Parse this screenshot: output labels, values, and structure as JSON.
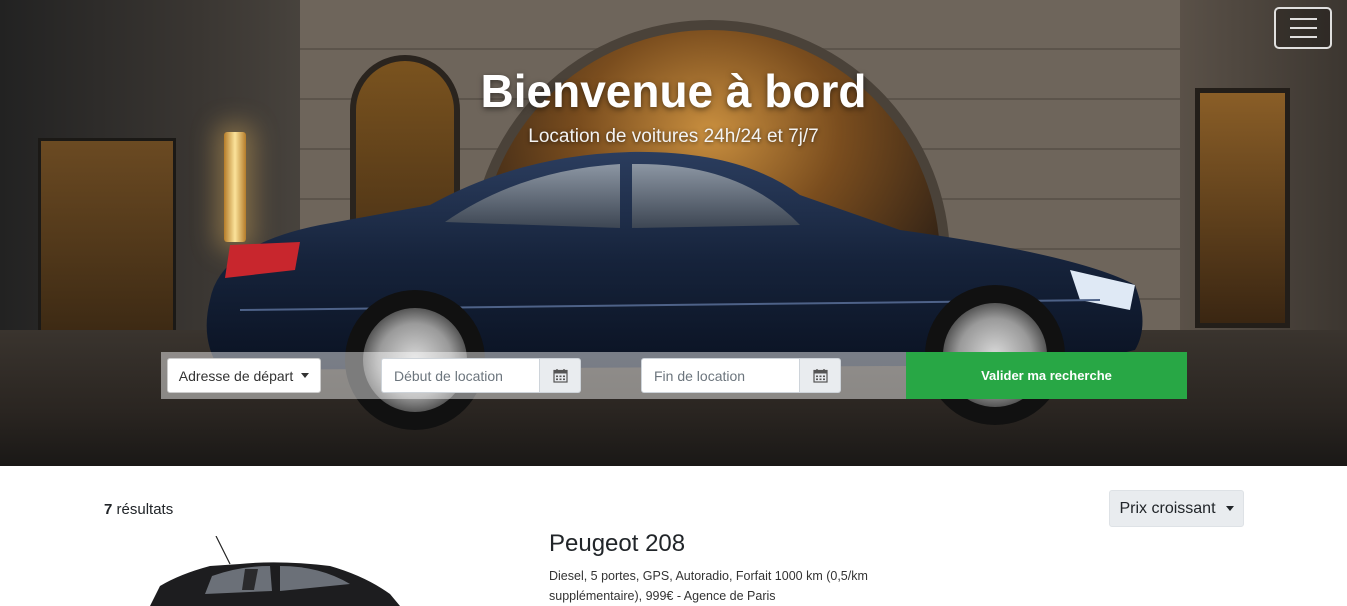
{
  "hero": {
    "title": "Bienvenue à bord",
    "subtitle": "Location de voitures 24h/24 et 7j/7"
  },
  "navbar": {
    "toggle_icon": "menu-icon"
  },
  "search": {
    "departure_label": "Adresse de départ",
    "start_placeholder": "Début de location",
    "end_placeholder": "Fin de location",
    "calendar_icon": "calendar-icon",
    "submit_label": "Valider ma recherche",
    "submit_color": "#28a745"
  },
  "results": {
    "count": "7",
    "count_label": "résultats",
    "sort_label": "Prix croissant",
    "items": [
      {
        "title": "Peugeot 208",
        "description": "Diesel, 5 portes, GPS, Autoradio, Forfait 1000 km (0,5/km supplémentaire), 999€ - Agence de Paris"
      }
    ]
  }
}
